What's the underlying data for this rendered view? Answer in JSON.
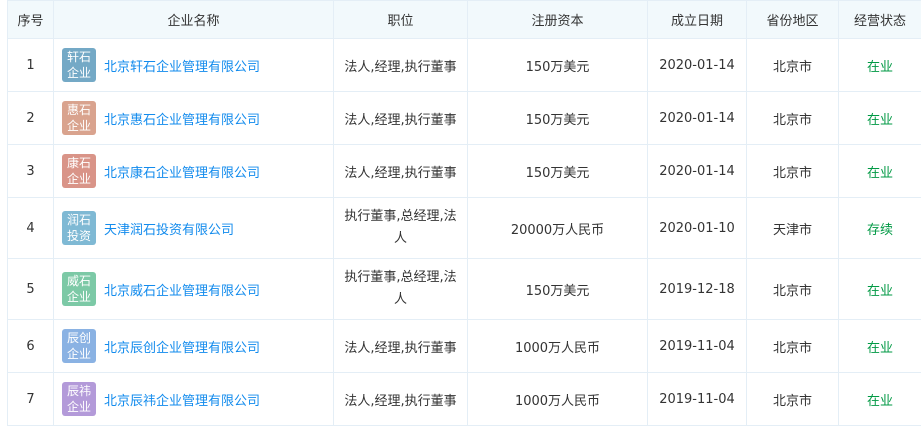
{
  "headers": [
    "序号",
    "企业名称",
    "职位",
    "注册资本",
    "成立日期",
    "省份地区",
    "经营状态"
  ],
  "rows": [
    {
      "index": "1",
      "logo_line1": "轩石",
      "logo_line2": "企业",
      "logo_color": "#74a9c6",
      "company": "北京轩石企业管理有限公司",
      "position": "法人,经理,执行董事",
      "capital": "150万美元",
      "date": "2020-01-14",
      "region": "北京市",
      "status": "在业"
    },
    {
      "index": "2",
      "logo_line1": "惠石",
      "logo_line2": "企业",
      "logo_color": "#d9a38e",
      "company": "北京惠石企业管理有限公司",
      "position": "法人,经理,执行董事",
      "capital": "150万美元",
      "date": "2020-01-14",
      "region": "北京市",
      "status": "在业"
    },
    {
      "index": "3",
      "logo_line1": "康石",
      "logo_line2": "企业",
      "logo_color": "#d99488",
      "company": "北京康石企业管理有限公司",
      "position": "法人,经理,执行董事",
      "capital": "150万美元",
      "date": "2020-01-14",
      "region": "北京市",
      "status": "在业"
    },
    {
      "index": "4",
      "logo_line1": "润石",
      "logo_line2": "投资",
      "logo_color": "#7fb9d4",
      "company": "天津润石投资有限公司",
      "position_line1": "执行董事,总经理,法",
      "position_line2": "人",
      "capital": "20000万人民币",
      "date": "2020-01-10",
      "region": "天津市",
      "status": "存续"
    },
    {
      "index": "5",
      "logo_line1": "威石",
      "logo_line2": "企业",
      "logo_color": "#7cc9a6",
      "company": "北京威石企业管理有限公司",
      "position_line1": "执行董事,总经理,法",
      "position_line2": "人",
      "capital": "150万美元",
      "date": "2019-12-18",
      "region": "北京市",
      "status": "在业"
    },
    {
      "index": "6",
      "logo_line1": "辰创",
      "logo_line2": "企业",
      "logo_color": "#8ab2e3",
      "company": "北京辰创企业管理有限公司",
      "position": "法人,经理,执行董事",
      "capital": "1000万人民币",
      "date": "2019-11-04",
      "region": "北京市",
      "status": "在业"
    },
    {
      "index": "7",
      "logo_line1": "辰祎",
      "logo_line2": "企业",
      "logo_color": "#b39ad9",
      "company": "北京辰祎企业管理有限公司",
      "position": "法人,经理,执行董事",
      "capital": "1000万人民币",
      "date": "2019-11-04",
      "region": "北京市",
      "status": "在业"
    }
  ]
}
